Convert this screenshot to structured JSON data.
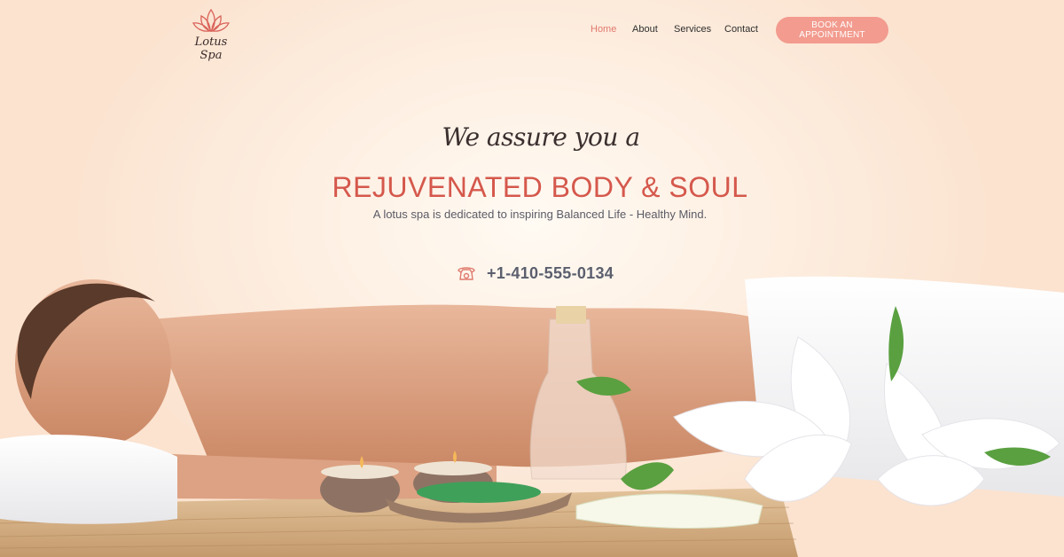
{
  "brand": {
    "name": "Lotus Spa",
    "logo_icon": "lotus-icon",
    "logo_color": "#d9625a"
  },
  "nav": {
    "items": [
      {
        "label": "Home",
        "active": true
      },
      {
        "label": "About",
        "active": false
      },
      {
        "label": "Services",
        "active": false
      },
      {
        "label": "Contact",
        "active": false
      }
    ],
    "cta_label": "BOOK AN APPOINTMENT"
  },
  "hero": {
    "tagline": "We assure you a",
    "headline": "REJUVENATED BODY & SOUL",
    "subline": "A lotus spa is dedicated to inspiring Balanced Life - Healthy Mind.",
    "phone_icon": "phone-icon",
    "phone": "+1-410-555-0134"
  },
  "colors": {
    "accent": "#d5584c",
    "cta": "#f29b8e",
    "nav_active": "#e07a6e",
    "text": "#5b5f6e"
  }
}
